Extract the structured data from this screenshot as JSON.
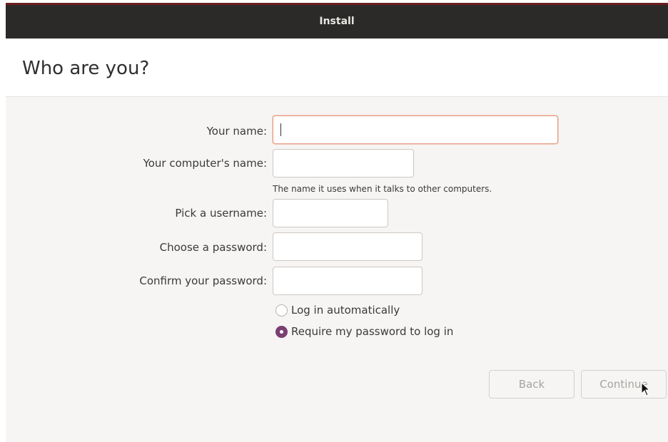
{
  "window": {
    "title": "Install"
  },
  "page": {
    "title": "Who are you?"
  },
  "form": {
    "name_label": "Your name:",
    "name_value": "",
    "computer_label": "Your computer's name:",
    "computer_value": "",
    "computer_hint": "The name it uses when it talks to other computers.",
    "username_label": "Pick a username:",
    "username_value": "",
    "password_label": "Choose a password:",
    "password_value": "",
    "confirm_label": "Confirm your password:",
    "confirm_value": ""
  },
  "login": {
    "auto_label": "Log in automatically",
    "auto_checked": false,
    "require_label": "Require my password to log in",
    "require_checked": true
  },
  "buttons": {
    "back_label": "Back",
    "continue_label": "Continue"
  },
  "colors": {
    "titlebar": "#2c2a29",
    "accent": "#7a3f72",
    "focus": "#e9a088"
  },
  "icons": {
    "pointer": "mouse-pointer-icon"
  }
}
